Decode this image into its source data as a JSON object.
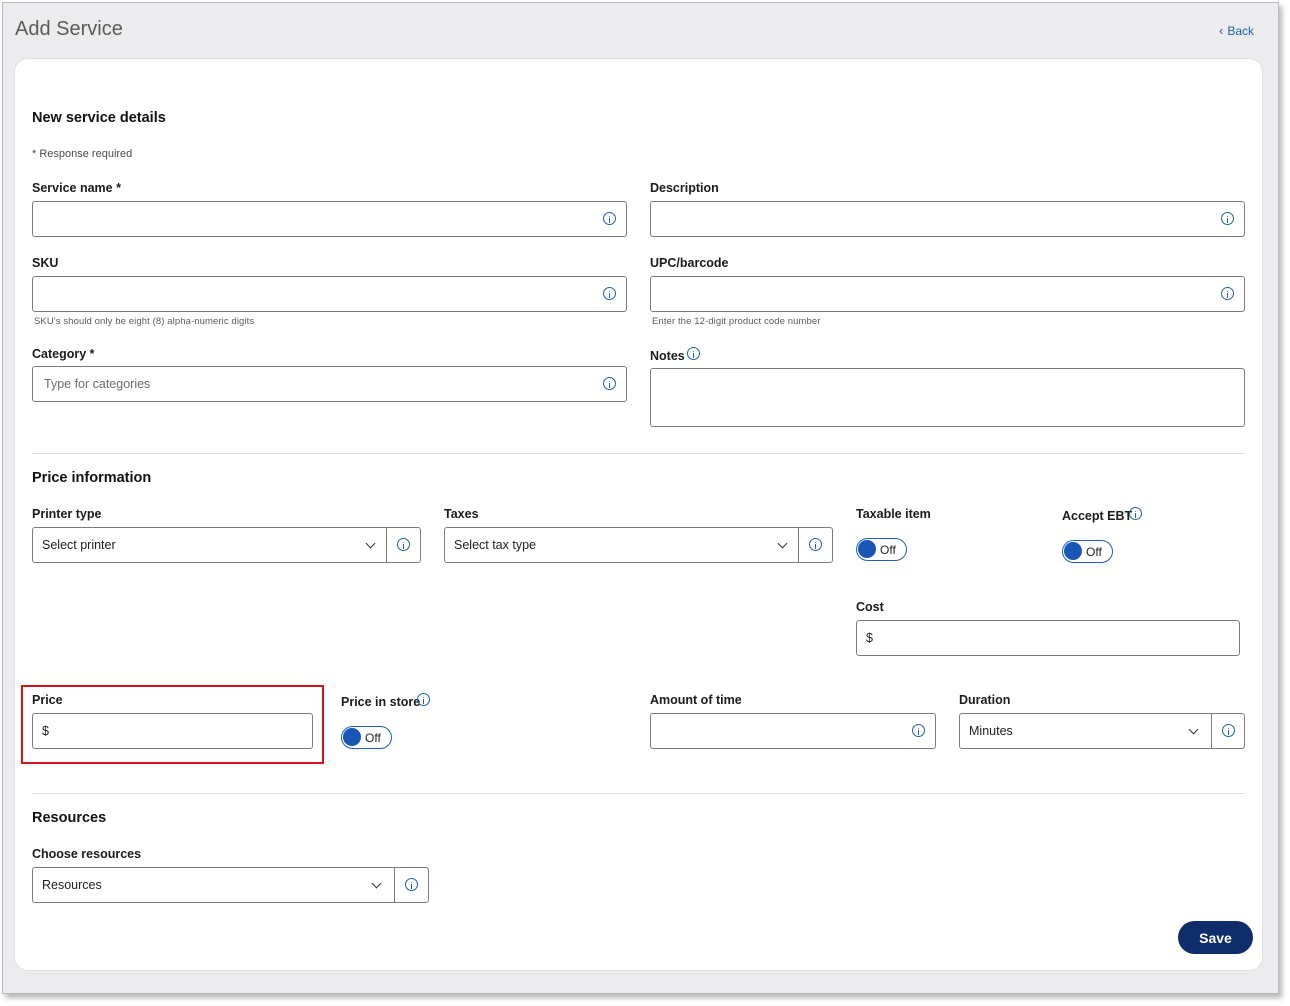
{
  "header": {
    "title": "Add Service",
    "back_label": "Back"
  },
  "details": {
    "heading": "New service details",
    "required_note": "* Response required",
    "service_name_label": "Service name *",
    "description_label": "Description",
    "sku_label": "SKU",
    "sku_hint": "SKU's should only be eight (8) alpha-numeric digits",
    "upc_label": "UPC/barcode",
    "upc_hint": "Enter the 12-digit product code number",
    "category_label": "Category *",
    "category_placeholder": "Type for categories",
    "notes_label": "Notes"
  },
  "price_info": {
    "heading": "Price information",
    "printer_label": "Printer type",
    "printer_value": "Select printer",
    "taxes_label": "Taxes",
    "taxes_value": "Select tax type",
    "taxable_label": "Taxable item",
    "taxable_state": "Off",
    "ebt_label": "Accept EBT",
    "ebt_state": "Off",
    "cost_label": "Cost",
    "cost_value": "$",
    "price_label": "Price",
    "price_value": "$",
    "price_in_store_label": "Price in store",
    "price_in_store_state": "Off",
    "amount_time_label": "Amount of time",
    "duration_label": "Duration",
    "duration_value": "Minutes"
  },
  "resources": {
    "heading": "Resources",
    "choose_label": "Choose resources",
    "choose_value": "Resources"
  },
  "actions": {
    "save_label": "Save"
  },
  "colors": {
    "accent": "#1f5fb5",
    "primary_button": "#0f2c6b",
    "highlight": "#d7141c"
  }
}
